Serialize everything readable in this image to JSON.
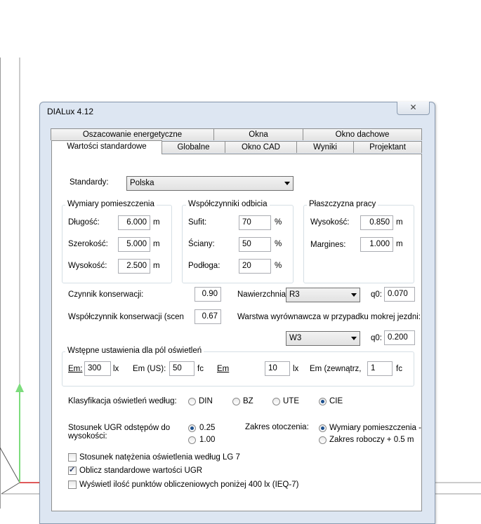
{
  "window": {
    "title": "DIALux 4.12"
  },
  "tabs_row1": [
    "Oszacowanie energetyczne",
    "Okna",
    "Okno dachowe"
  ],
  "tabs_row2": [
    "Wartości standardowe",
    "Globalne",
    "Okno CAD",
    "Wyniki",
    "Projektant"
  ],
  "standards": {
    "label": "Standardy:",
    "value": "Polska"
  },
  "room": {
    "title": "Wymiary pomieszczenia",
    "length_label": "Długość:",
    "length": "6.000",
    "width_label": "Szerokość:",
    "width": "5.000",
    "height_label": "Wysokość:",
    "height": "2.500",
    "unit": "m"
  },
  "reflect": {
    "title": "Współczynniki odbicia",
    "ceiling_label": "Sufit:",
    "ceiling": "70",
    "walls_label": "Ściany:",
    "walls": "50",
    "floor_label": "Podłoga:",
    "floor": "20",
    "unit": "%"
  },
  "workplane": {
    "title": "Płaszczyzna pracy",
    "height_label": "Wysokość:",
    "height": "0.850",
    "margin_label": "Margines:",
    "margin": "1.000",
    "unit": "m"
  },
  "maintenance": {
    "factor_label": "Czynnik konserwacji:",
    "factor": "0.90",
    "surface_label": "Nawierzchnia",
    "surface": "R3",
    "q0_label": "q0:",
    "q0": "0.070",
    "scene_label": "Współczynnik konserwacji (scena",
    "scene": "0.67",
    "wet_label": "Warstwa wyrównawcza w przypadku mokrej jezdni:",
    "wet": "W3",
    "wet_q0_label": "q0:",
    "wet_q0": "0.200"
  },
  "fields": {
    "title": "Wstępne ustawienia dla pól oświetleń",
    "em_label": "Em:",
    "em": "300",
    "em_unit": "lx",
    "em_us_label": "Em (US):",
    "em_us": "50",
    "em_us_unit": "fc",
    "em2_label": "Em",
    "em2": "10",
    "em2_unit": "lx",
    "em_ext_label": "Em (zewnątrz,",
    "em_ext": "1",
    "em_ext_unit": "fc"
  },
  "glare": {
    "label": "Klasyfikacja oświetleń według:",
    "options": [
      "DIN",
      "BZ",
      "UTE",
      "CIE"
    ],
    "selected": "CIE"
  },
  "ugr": {
    "label": "Stosunek UGR odstępów do wysokości:",
    "options": [
      "0.25",
      "1.00"
    ],
    "selected": "0.25",
    "range_label": "Zakres otoczenia:",
    "range_options": [
      "Wymiary pomieszczenia -",
      "Zakres roboczy + 0.5 m"
    ],
    "range_selected": "Wymiary pomieszczenia -"
  },
  "checks": [
    {
      "label": "Stosunek natężenia oświetlenia według LG 7",
      "checked": false
    },
    {
      "label": "Oblicz standardowe wartości UGR",
      "checked": true
    },
    {
      "label": "Wyświetl ilość punktów obliczeniowych poniżej 400 lx (IEQ-7)",
      "checked": false
    }
  ],
  "colors": {
    "axis_y": "#7ddc7d",
    "axis_x": "#e05a5a",
    "dialog_bg": "#dde6f2"
  }
}
